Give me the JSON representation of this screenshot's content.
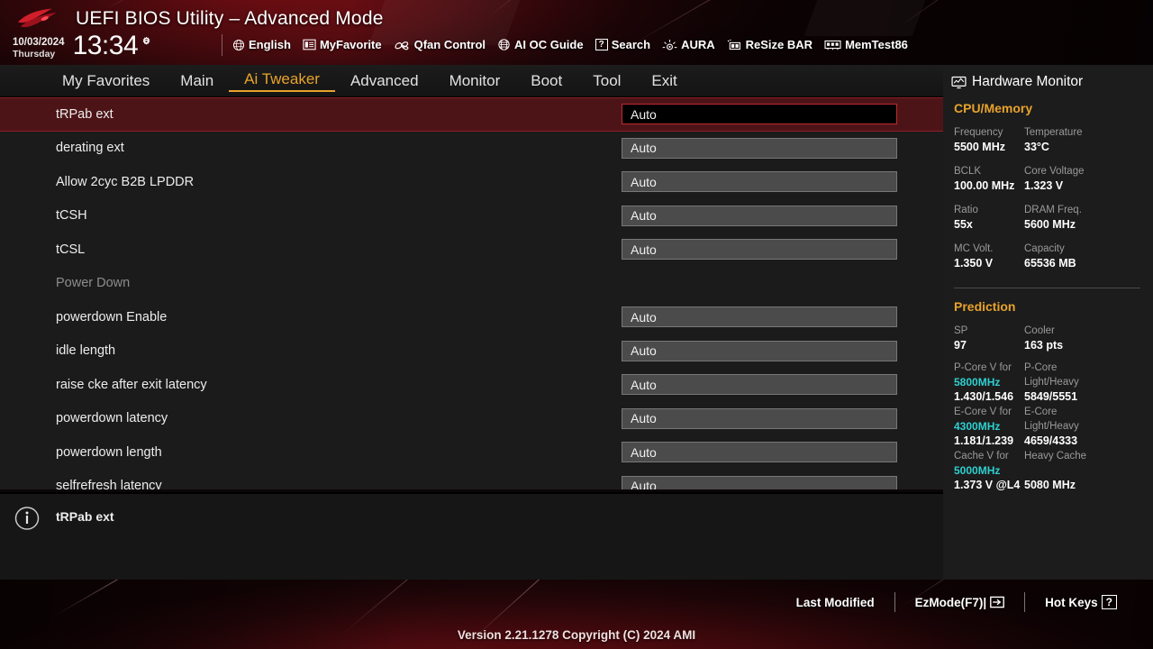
{
  "header": {
    "title": "UEFI BIOS Utility – Advanced Mode",
    "logo_icon": "rog-logo-icon",
    "date": "10/03/2024",
    "day": "Thursday",
    "time": "13:34",
    "gear_icon": "gear-icon",
    "tools": [
      {
        "label": "English",
        "icon": "globe-icon"
      },
      {
        "label": "MyFavorite",
        "icon": "star-list-icon"
      },
      {
        "label": "Qfan Control",
        "icon": "fan-icon"
      },
      {
        "label": "AI OC Guide",
        "icon": "ai-brain-icon"
      },
      {
        "label": "Search",
        "icon": "question-box-icon"
      },
      {
        "label": "AURA",
        "icon": "aura-light-icon"
      },
      {
        "label": "ReSize BAR",
        "icon": "resize-bar-icon"
      },
      {
        "label": "MemTest86",
        "icon": "memory-module-icon"
      }
    ]
  },
  "nav": {
    "items": [
      {
        "label": "My Favorites",
        "active": false
      },
      {
        "label": "Main",
        "active": false
      },
      {
        "label": "Ai Tweaker",
        "active": true
      },
      {
        "label": "Advanced",
        "active": false
      },
      {
        "label": "Monitor",
        "active": false
      },
      {
        "label": "Boot",
        "active": false
      },
      {
        "label": "Tool",
        "active": false
      },
      {
        "label": "Exit",
        "active": false
      }
    ]
  },
  "settings": {
    "rows": [
      {
        "label": "tRPab ext",
        "value": "Auto",
        "selected": true,
        "is_header": false
      },
      {
        "label": "derating ext",
        "value": "Auto",
        "selected": false,
        "is_header": false
      },
      {
        "label": "Allow 2cyc B2B LPDDR",
        "value": "Auto",
        "selected": false,
        "is_header": false
      },
      {
        "label": "tCSH",
        "value": "Auto",
        "selected": false,
        "is_header": false
      },
      {
        "label": "tCSL",
        "value": "Auto",
        "selected": false,
        "is_header": false
      },
      {
        "label": "Power Down",
        "value": "",
        "selected": false,
        "is_header": true
      },
      {
        "label": "powerdown Enable",
        "value": "Auto",
        "selected": false,
        "is_header": false
      },
      {
        "label": "idle length",
        "value": "Auto",
        "selected": false,
        "is_header": false
      },
      {
        "label": "raise cke after exit latency",
        "value": "Auto",
        "selected": false,
        "is_header": false
      },
      {
        "label": "powerdown latency",
        "value": "Auto",
        "selected": false,
        "is_header": false
      },
      {
        "label": "powerdown length",
        "value": "Auto",
        "selected": false,
        "is_header": false
      },
      {
        "label": "selfrefresh latency",
        "value": "Auto",
        "selected": false,
        "is_header": false
      }
    ]
  },
  "info": {
    "icon": "info-circle-icon",
    "text": "tRPab ext"
  },
  "hardware_monitor": {
    "title": "Hardware Monitor",
    "title_icon": "monitor-icon",
    "cpu_memory": {
      "section": "CPU/Memory",
      "entries": [
        {
          "key": "Frequency",
          "value": "5500 MHz"
        },
        {
          "key": "Temperature",
          "value": "33°C"
        },
        {
          "key": "BCLK",
          "value": "100.00 MHz"
        },
        {
          "key": "Core Voltage",
          "value": "1.323 V"
        },
        {
          "key": "Ratio",
          "value": "55x"
        },
        {
          "key": "DRAM Freq.",
          "value": "5600 MHz"
        },
        {
          "key": "MC Volt.",
          "value": "1.350 V"
        },
        {
          "key": "Capacity",
          "value": "65536 MB"
        }
      ]
    },
    "prediction": {
      "section": "Prediction",
      "entries": [
        {
          "key": "SP",
          "value": "97"
        },
        {
          "key": "Cooler",
          "value": "163 pts"
        }
      ],
      "detail": [
        {
          "key_line1": "P-Core V for",
          "key_line2": "5800MHz",
          "value": "1.430/1.546",
          "key2_line1": "P-Core",
          "key2_line2": "Light/Heavy",
          "value2": "5849/5551"
        },
        {
          "key_line1": "E-Core V for",
          "key_line2": "4300MHz",
          "value": "1.181/1.239",
          "key2_line1": "E-Core",
          "key2_line2": "Light/Heavy",
          "value2": "4659/4333"
        },
        {
          "key_line1": "Cache V for",
          "key_line2": "5000MHz",
          "value": "1.373 V @L4",
          "key2_line1": "Heavy Cache",
          "key2_line2": "",
          "value2": "5080 MHz"
        }
      ]
    }
  },
  "footer": {
    "links": [
      {
        "label": "Last Modified",
        "icon": ""
      },
      {
        "label": "EzMode(F7)|",
        "icon": "arrow-into-box-icon"
      },
      {
        "label": "Hot Keys",
        "icon": "question-box-icon"
      }
    ],
    "version": "Version 2.21.1278 Copyright (C) 2024 AMI"
  },
  "colors": {
    "accent_gold": "#e8a32b",
    "brand_red": "#8e1118",
    "cyan": "#2fd0d0",
    "selected_row_bg": "#4d1417"
  }
}
